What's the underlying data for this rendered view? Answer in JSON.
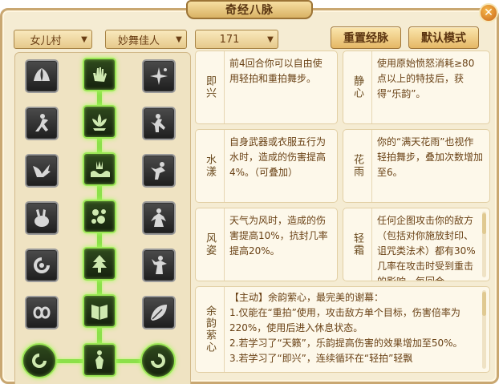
{
  "window": {
    "title": "奇经八脉"
  },
  "filters": {
    "school": "女儿村",
    "faction": "妙舞佳人",
    "level": "171"
  },
  "actions": {
    "reset_label": "重置经脉",
    "default_label": "默认模式"
  },
  "tree": {
    "left_icons": [
      "wings-icon",
      "dancer-icon",
      "crane-icon",
      "rabbit-icon",
      "swirl-icon",
      "knot-icon",
      "orb-icon"
    ],
    "center_icons": [
      "hand-icon",
      "lotus-icon",
      "wave-icon",
      "flower-cluster-icon",
      "tree-icon",
      "book-icon",
      "figure-icon"
    ],
    "right_icons": [
      "sparkle-icon",
      "dancer-icon",
      "figure-icon",
      "dancer-icon",
      "dancer-icon",
      "leaf-icon",
      "orb-icon"
    ]
  },
  "skills": [
    {
      "name": "即兴",
      "desc": "前4回合你可以自由使用轻拍和重拍舞步。"
    },
    {
      "name": "静心",
      "desc": "使用原始愤怒消耗≥80点以上的特技后，获得“乐韵”。"
    },
    {
      "name": "水漾",
      "desc": "自身武器或衣服五行为水时，造成的伤害提高4%。（可叠加）"
    },
    {
      "name": "花雨",
      "desc": "你的“满天花雨”也视作轻拍舞步，叠加次数增加至6。"
    },
    {
      "name": "风姿",
      "desc": "天气为风时，造成的伤害提高10%，抗封几率提高20%。"
    },
    {
      "name": "轻霜",
      "desc": "任何企图攻击你的敌方（包括对你施放封印、诅咒类法术）都有30%几率在攻击时受到重击的影响，每回合"
    }
  ],
  "main_skill": {
    "name": "余韵萦心",
    "lines": [
      "【主动】余韵萦心，最完美的谢幕：",
      "1.仅能在“重拍”使用，攻击敌方单个目标，伤害倍率为220%，使用后进入休息状态。",
      "2.若学习了“天籁”，乐韵提高伤害的效果增加至50%。",
      "3.若学习了“即兴”，连续循环在“轻拍”轻飘"
    ]
  }
}
